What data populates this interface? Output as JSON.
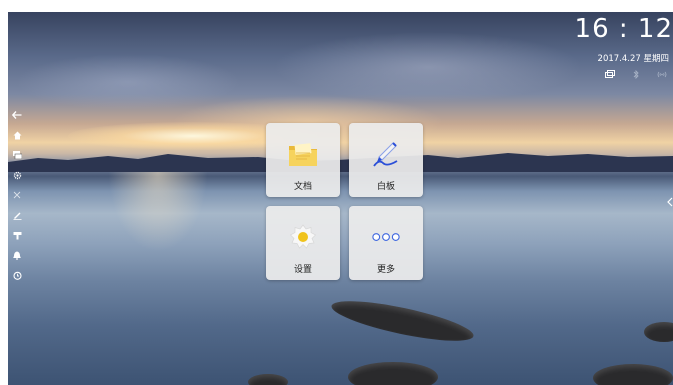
{
  "status": {
    "time": "16 : 12",
    "date": "2017.4.27 星期四",
    "icons": [
      "screen-mirror-icon",
      "bluetooth-icon",
      "wifi-icon"
    ]
  },
  "sidebar": {
    "items": [
      {
        "name": "back-icon",
        "glyph": "←"
      },
      {
        "name": "home-icon",
        "glyph": "⌂"
      },
      {
        "name": "windows-icon",
        "glyph": "▬"
      },
      {
        "name": "settings-gear-icon",
        "glyph": "⚙"
      },
      {
        "name": "close-x-icon",
        "glyph": "✕"
      },
      {
        "name": "pen-icon",
        "glyph": "✎"
      },
      {
        "name": "brush-icon",
        "glyph": "▼"
      },
      {
        "name": "bell-icon",
        "glyph": "♟"
      },
      {
        "name": "timer-icon",
        "glyph": "◷"
      }
    ]
  },
  "tiles": [
    {
      "name": "documents",
      "label": "文档",
      "icon": "folder-icon"
    },
    {
      "name": "whiteboard",
      "label": "白板",
      "icon": "pen-draw-icon"
    },
    {
      "name": "settings",
      "label": "设置",
      "icon": "gear-icon"
    },
    {
      "name": "more",
      "label": "更多",
      "icon": "more-dots-icon"
    }
  ],
  "colors": {
    "folder": "#f2c84b",
    "pen": "#2b4fd8",
    "gear": "#f0c31c",
    "dots": "#3f67e0"
  }
}
